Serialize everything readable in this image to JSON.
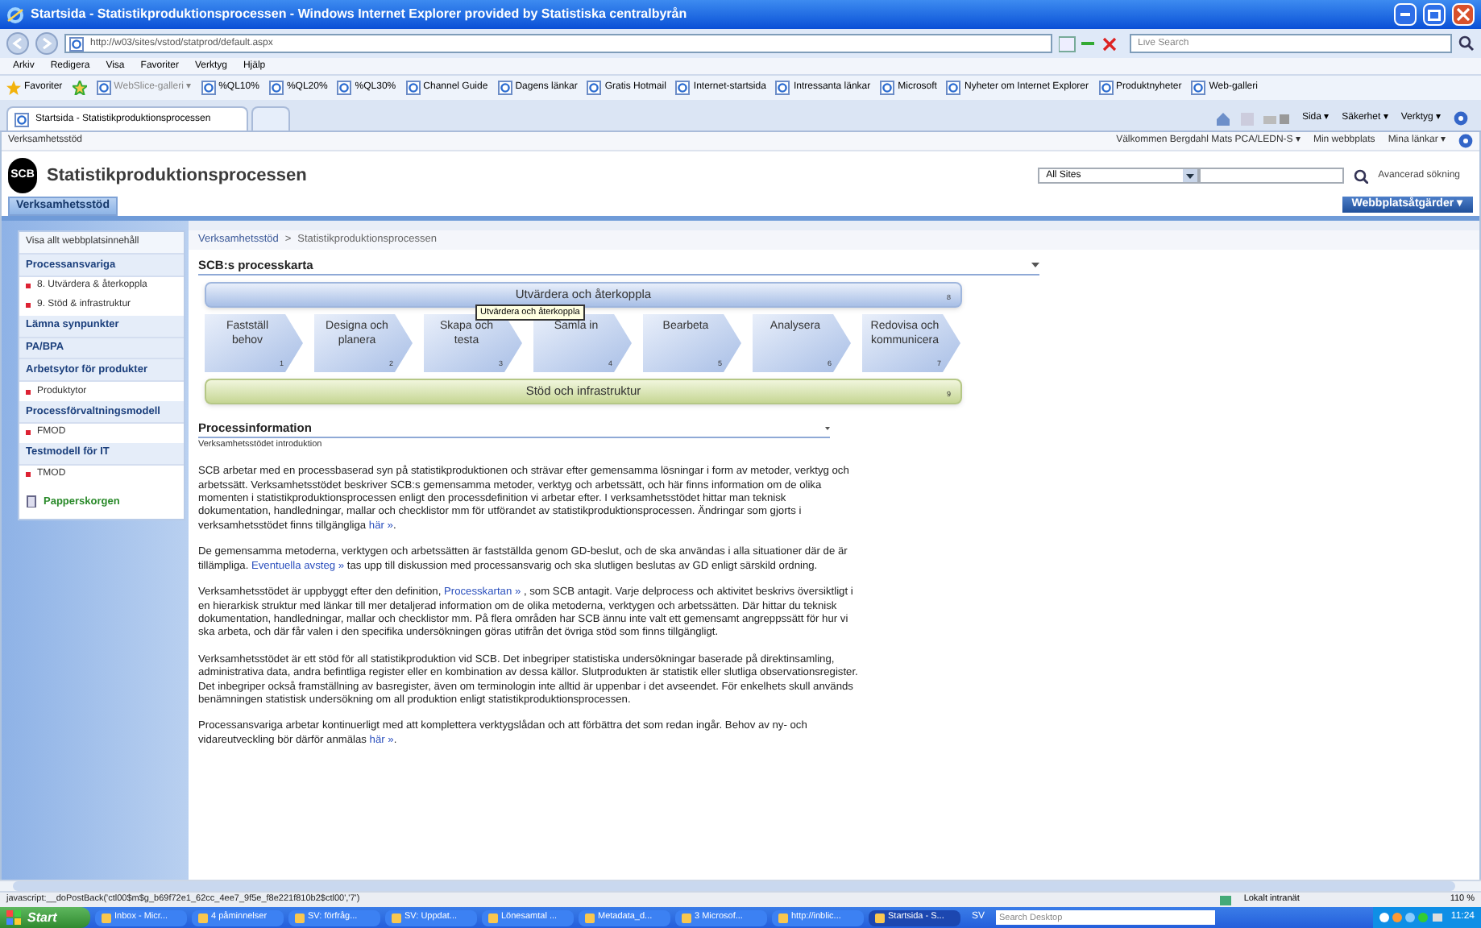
{
  "window": {
    "title": "Startsida - Statistikproduktionsprocessen - Windows Internet Explorer provided by Statistiska centralbyrån"
  },
  "browser": {
    "address": "http://w03/sites/vstod/statprod/default.aspx",
    "search_placeholder": "Live Search",
    "menu": [
      "Arkiv",
      "Redigera",
      "Visa",
      "Favoriter",
      "Verktyg",
      "Hjälp"
    ],
    "favorites_label": "Favoriter",
    "favorites": [
      "WebSlice-galleri ▾",
      "%QL10%",
      "%QL20%",
      "%QL30%",
      "Channel Guide",
      "Dagens länkar",
      "Gratis Hotmail",
      "Internet-startsida",
      "Intressanta länkar",
      "Microsoft",
      "Nyheter om Internet Explorer",
      "Produktnyheter",
      "Web-galleri"
    ],
    "tabs": [
      {
        "label": "Startsida - Statistikproduktionsprocessen",
        "selected": true
      },
      {
        "selected": false
      }
    ],
    "commands": [
      "Sida ▾",
      "Säkerhet ▾",
      "Verktyg ▾"
    ]
  },
  "page": {
    "site_label": "Verksamhetsstöd",
    "welcome": "Välkommen Bergdahl Mats PCA/LEDN-S ▾",
    "links": [
      "Min webbplats",
      "Mina länkar ▾"
    ],
    "logo_text": "SCB",
    "site_title": "Statistikproduktionsprocessen",
    "search_scope": "All Sites",
    "advanced_search": "Avancerad sökning",
    "nav_tabs": [
      {
        "label": "Verksamhetsstöd",
        "selected": true
      }
    ],
    "site_actions": "Webbplatsåtgärder ▾"
  },
  "sidebar": {
    "view_all": "Visa allt webbplatsinnehåll",
    "sections": [
      {
        "heading": "Processansvariga",
        "items": [
          "8. Utvärdera & återkoppla",
          "9. Stöd & infrastruktur"
        ]
      },
      {
        "heading": "Lämna synpunkter"
      },
      {
        "heading": "PA/BPA"
      },
      {
        "heading": "Arbetsytor för produkter",
        "items": [
          "Produktytor"
        ]
      },
      {
        "heading": "Processförvaltningsmodell",
        "items": [
          "FMOD"
        ]
      },
      {
        "heading": "Testmodell för IT",
        "items": [
          "TMOD"
        ]
      }
    ],
    "recycle_bin": "Papperskorgen"
  },
  "breadcrumb": {
    "items": [
      "Verksamhetsstöd",
      "Statistikproduktionsprocessen"
    ],
    "separator": ">"
  },
  "process_map": {
    "title": "SCB:s processkarta",
    "top": {
      "label": "Utvärdera och återkoppla",
      "number": "8"
    },
    "steps": [
      {
        "label": "Fastställ behov",
        "number": "1"
      },
      {
        "label": "Designa och planera",
        "number": "2"
      },
      {
        "label": "Skapa och testa",
        "number": "3"
      },
      {
        "label": "Samla in",
        "number": "4"
      },
      {
        "label": "Bearbeta",
        "number": "5"
      },
      {
        "label": "Analysera",
        "number": "6"
      },
      {
        "label": "Redovisa och kommunicera",
        "number": "7"
      }
    ],
    "bottom": {
      "label": "Stöd och infrastruktur",
      "number": "9"
    },
    "tooltip": "Utvärdera och återkoppla"
  },
  "process_info": {
    "title": "Processinformation",
    "subtitle": "Verksamhetsstödet introduktion",
    "paragraphs": [
      [
        {
          "text": "SCB arbetar med en processbaserad syn på statistikproduktionen och strävar efter gemensamma lösningar i form av metoder, verktyg och arbetssätt. Verksamhetsstödet beskriver SCB:s gemensamma metoder, verktyg och arbetssätt, och här finns information om de olika momenten i statistikproduktionsprocessen enligt den processdefinition vi arbetar efter. I verksamhetsstödet hittar man teknisk dokumentation, handledningar, mallar och checklistor mm för utförandet av statistikproduktionsprocessen. Ändringar som gjorts i verksamhetsstödet finns tillgängliga "
        },
        {
          "link": "här »"
        },
        {
          "text": "."
        }
      ],
      [
        {
          "text": "De gemensamma metoderna, verktygen och arbetssätten är fastställda genom GD-beslut, och de ska användas i alla situationer där de är tillämpliga. "
        },
        {
          "link": "Eventuella avsteg »"
        },
        {
          "text": " tas upp till diskussion med processansvarig och ska slutligen beslutas av GD enligt särskild ordning."
        }
      ],
      [
        {
          "text": "Verksamhetsstödet är uppbyggt efter den definition, "
        },
        {
          "link": "Processkartan »"
        },
        {
          "text": " , som SCB antagit. Varje delprocess och aktivitet beskrivs översiktligt i en hierarkisk struktur med länkar till mer detaljerad information om de olika metoderna, verktygen och arbetssätten. Där hittar du teknisk dokumentation, handledningar, mallar och checklistor mm. På flera områden har SCB ännu inte valt ett gemensamt angreppssätt för hur vi ska arbeta, och där får valen i den specifika undersökningen göras utifrån det övriga stöd som finns tillgängligt."
        }
      ],
      [
        {
          "text": "Verksamhetsstödet är ett stöd för all statistikproduktion vid SCB. Det inbegriper statistiska undersökningar baserade på direktinsamling, administrativa data, andra befintliga register eller en kombination av dessa källor. Slutprodukten är statistik eller slutliga observationsregister. Det inbegriper också framställning av basregister, även om terminologin inte alltid är uppenbar i det avseendet. För enkelhets skull används benämningen statistisk undersökning om all produktion enligt statistikproduktionsprocessen."
        }
      ],
      [
        {
          "text": "Processansvariga arbetar kontinuerligt med att komplettera verktygslådan och att förbättra det som redan ingår. Behov av ny- och vidareutveckling bör därför anmälas "
        },
        {
          "link": "här »"
        },
        {
          "text": "."
        }
      ]
    ]
  },
  "status_bar": {
    "text": "javascript:__doPostBack('ctl00$m$g_b69f72e1_62cc_4ee7_9f5e_f8e221f810b2$ctl00','7')",
    "zone": "Lokalt intranät",
    "zoom": "110 %"
  },
  "taskbar": {
    "start": "Start",
    "items": [
      {
        "label": "Inbox - Micr...",
        "selected": false
      },
      {
        "label": "4 påminnelser",
        "selected": false
      },
      {
        "label": "SV: förfråg...",
        "selected": false
      },
      {
        "label": "SV: Uppdat...",
        "selected": false
      },
      {
        "label": "Lönesamtal ...",
        "selected": false
      },
      {
        "label": "Metadata_d...",
        "selected": false
      },
      {
        "label": "3 Microsof...",
        "selected": false
      },
      {
        "label": "http://inblic...",
        "selected": false
      },
      {
        "label": "Startsida - S...",
        "selected": true
      }
    ],
    "language": "SV",
    "search_placeholder": "Search Desktop",
    "clock": "11:24"
  }
}
